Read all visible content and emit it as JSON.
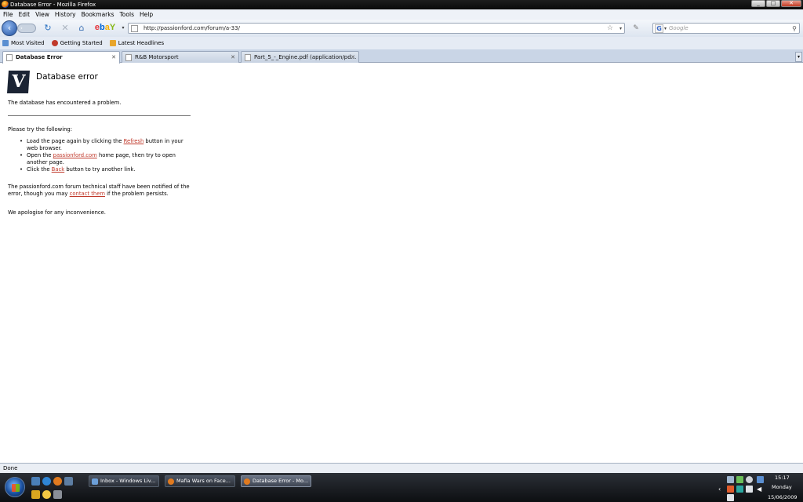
{
  "window": {
    "title": "Database Error - Mozilla Firefox",
    "minimize": "_",
    "maximize": "□",
    "close": "✕"
  },
  "menu": [
    "File",
    "Edit",
    "View",
    "History",
    "Bookmarks",
    "Tools",
    "Help"
  ],
  "nav": {
    "back": "‹",
    "forward": "›",
    "reload": "↻",
    "stop": "✕",
    "home": "⌂",
    "ebay": {
      "e": "e",
      "b": "b",
      "a": "a",
      "y": "Y"
    },
    "url": "http://passionford.com/forum/a-33/",
    "star": "☆",
    "search_placeholder": "Google",
    "search_engine_letter": "G"
  },
  "bookmarks": [
    "Most Visited",
    "Getting Started",
    "Latest Headlines"
  ],
  "tabs": [
    {
      "label": "Database Error",
      "active": true
    },
    {
      "label": "R&B Motorsport",
      "active": false
    },
    {
      "label": "Part_5_-_Engine.pdf (application/pd...",
      "active": false
    }
  ],
  "content": {
    "logo_letter": "V",
    "title": "Database error",
    "message1": "The database has encountered a problem.",
    "message2": "Please try the following:",
    "steps": [
      {
        "pre": "Load the page again by clicking the ",
        "link": "Refresh",
        "post": " button in your web browser."
      },
      {
        "pre": "Open the ",
        "link": "passionford.com",
        "post": " home page, then try to open another page."
      },
      {
        "pre": "Click the ",
        "link": "Back",
        "post": " button to try another link."
      }
    ],
    "message3_pre": "The passionford.com forum technical staff have been notified of the error, though you may ",
    "message3_link": "contact them",
    "message3_post": " if the problem persists.",
    "message4": "We apologise for any inconvenience."
  },
  "status": "Done",
  "taskbar": {
    "tasks": [
      {
        "label": "Inbox - Windows Liv...",
        "active": false
      },
      {
        "label": "Mafia Wars on Face...",
        "active": false
      },
      {
        "label": "Database Error - Mo...",
        "active": true
      }
    ],
    "clock": {
      "time": "15:17",
      "day": "Monday",
      "date": "15/06/2009"
    }
  },
  "colors": {
    "link": "#c0392b",
    "logo_bg": "#1b2434",
    "taskbar": "#0d0f12"
  }
}
